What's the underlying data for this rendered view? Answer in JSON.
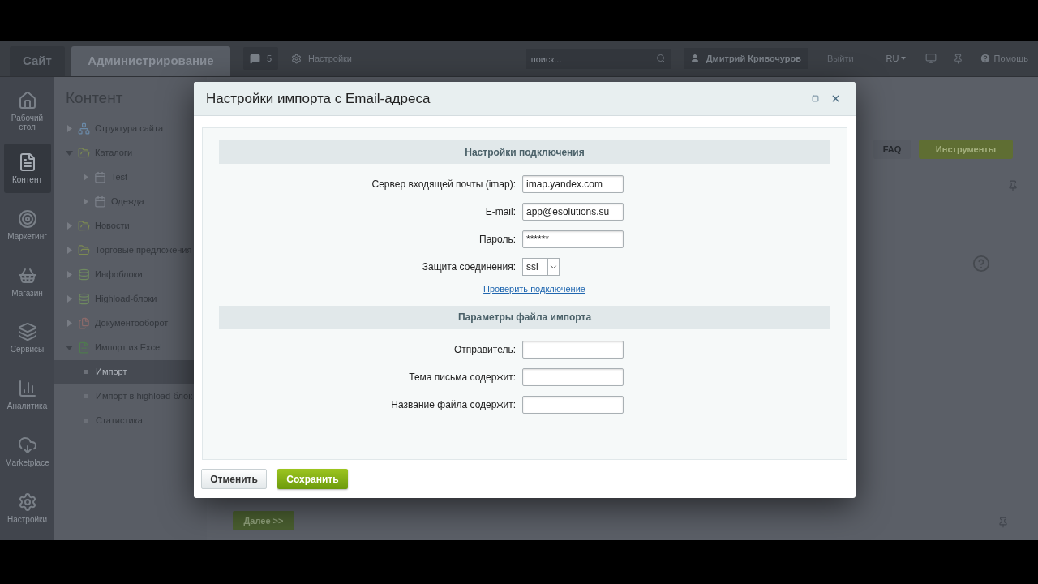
{
  "topbar": {
    "tabs": [
      {
        "label": "Сайт",
        "selected": false
      },
      {
        "label": "Администрирование",
        "selected": true
      }
    ],
    "notifications": "5",
    "settings_link": "Настройки",
    "search": {
      "placeholder": "поиск..."
    },
    "user": "Дмитрий Кривочуров",
    "logout": "Выйти",
    "language": "RU",
    "help": "Помощь"
  },
  "nav": [
    {
      "label": "Рабочий стол",
      "selected": false
    },
    {
      "label": "Контент",
      "selected": true
    },
    {
      "label": "Маркетинг",
      "selected": false
    },
    {
      "label": "Магазин",
      "selected": false
    },
    {
      "label": "Сервисы",
      "selected": false
    },
    {
      "label": "Аналитика",
      "selected": false
    },
    {
      "label": "Marketplace",
      "selected": false
    },
    {
      "label": "Настройки",
      "selected": false
    }
  ],
  "tree": {
    "title": "Контент",
    "items": [
      {
        "label": "Структура сайта",
        "kind": "node",
        "expanded": false,
        "selected": false
      },
      {
        "label": "Каталоги",
        "kind": "node",
        "expanded": true,
        "selected": false,
        "children": [
          {
            "label": "Test",
            "kind": "node",
            "expanded": false,
            "selected": false
          },
          {
            "label": "Одежда",
            "kind": "node",
            "expanded": false,
            "selected": false
          }
        ]
      },
      {
        "label": "Новости",
        "kind": "node",
        "expanded": false,
        "selected": false
      },
      {
        "label": "Торговые предложения",
        "kind": "node",
        "expanded": false,
        "selected": false
      },
      {
        "label": "Инфоблоки",
        "kind": "node",
        "expanded": false,
        "selected": false
      },
      {
        "label": "Highload-блоки",
        "kind": "node",
        "expanded": false,
        "selected": false
      },
      {
        "label": "Документооборот",
        "kind": "node",
        "expanded": false,
        "selected": false
      },
      {
        "label": "Импорт из Excel",
        "kind": "node",
        "expanded": true,
        "selected": false,
        "children": [
          {
            "label": "Импорт",
            "kind": "page",
            "selected": true
          },
          {
            "label": "Импорт в highload-блок",
            "kind": "page",
            "selected": false
          },
          {
            "label": "Статистика",
            "kind": "page",
            "selected": false
          }
        ]
      }
    ]
  },
  "main": {
    "buttons": [
      {
        "label": "FAQ",
        "kind": "plain"
      },
      {
        "label": "Инструменты",
        "kind": "primary"
      }
    ],
    "next_button": "Далее >>"
  },
  "dialog": {
    "title": "Настройки импорта с Email-адреса",
    "sections": [
      {
        "title": "Настройки подключения",
        "fields": [
          {
            "label": "Сервер входящей почты (imap):",
            "kind": "text",
            "value": "imap.yandex.com"
          },
          {
            "label": "E-mail:",
            "kind": "text",
            "value": "app@esolutions.su"
          },
          {
            "label": "Пароль:",
            "kind": "password",
            "value": "******"
          },
          {
            "label": "Защита соединения:",
            "kind": "select",
            "value": "ssl"
          }
        ],
        "link": "Проверить подключение"
      },
      {
        "title": "Параметры файла импорта",
        "fields": [
          {
            "label": "Отправитель:",
            "kind": "text"
          },
          {
            "label": "Тема письма содержит:",
            "kind": "text"
          },
          {
            "label": "Название файла содержит:",
            "kind": "text"
          }
        ]
      }
    ],
    "buttons": [
      {
        "label": "Отменить",
        "kind": "plain"
      },
      {
        "label": "Сохранить",
        "kind": "primary"
      }
    ]
  }
}
